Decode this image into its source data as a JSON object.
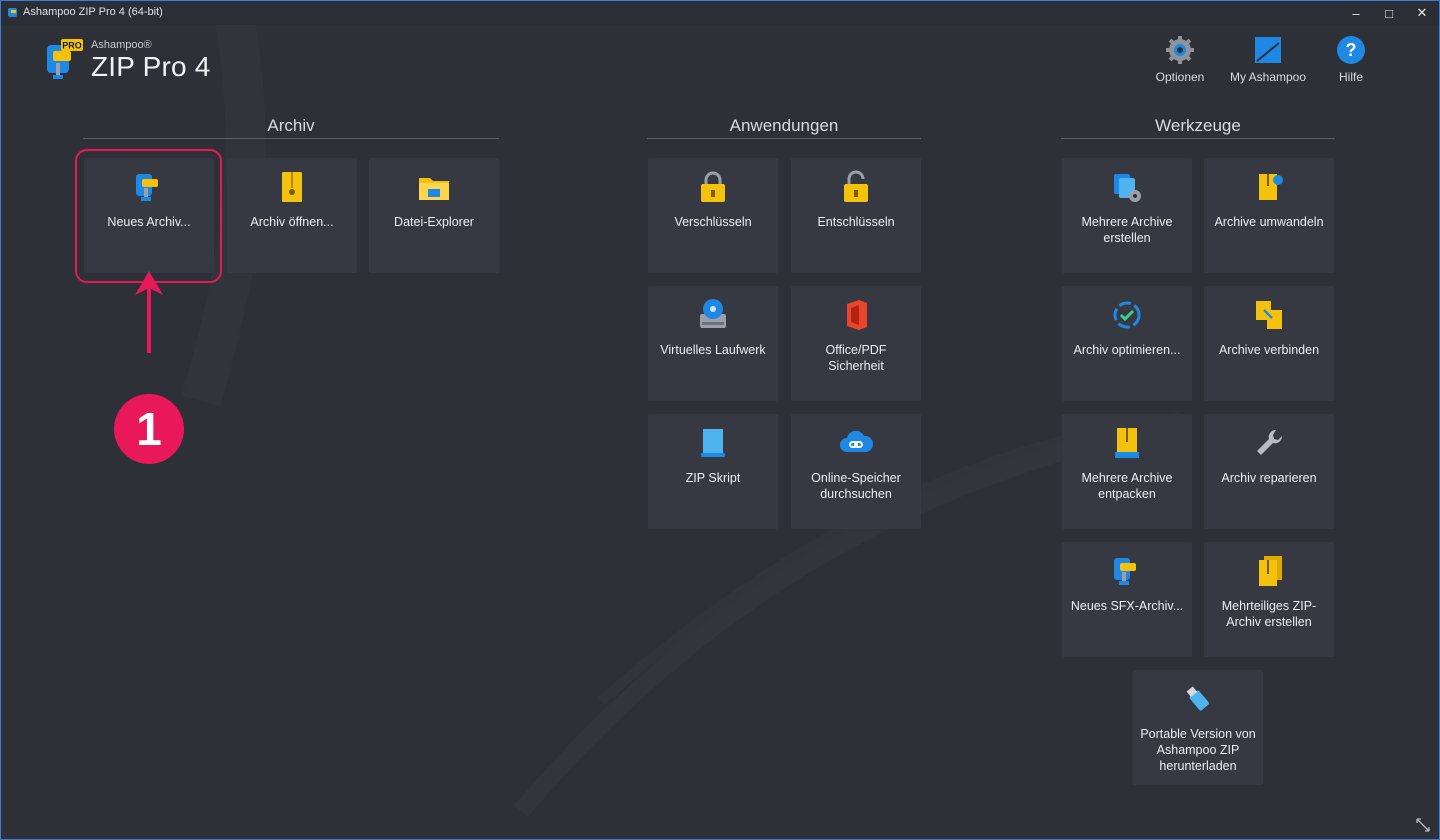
{
  "window": {
    "title": "Ashampoo ZIP Pro 4 (64-bit)",
    "controls": {
      "minimize": "–",
      "maximize": "□",
      "close": "✕"
    }
  },
  "logo": {
    "brand_small": "Ashampoo®",
    "brand_big": "ZIP Pro 4",
    "badge": "PRO"
  },
  "top_buttons": [
    {
      "label": "Optionen",
      "icon": "gear-icon"
    },
    {
      "label": "My Ashampoo",
      "icon": "ashampoo-icon"
    },
    {
      "label": "Hilfe",
      "icon": "help-icon"
    }
  ],
  "sections": {
    "archiv": {
      "title": "Archiv",
      "tiles": [
        {
          "label": "Neues Archiv...",
          "icon": "new-archive-icon"
        },
        {
          "label": "Archiv öffnen...",
          "icon": "open-archive-icon"
        },
        {
          "label": "Datei-Explorer",
          "icon": "folder-icon"
        }
      ]
    },
    "anwendungen": {
      "title": "Anwendungen",
      "tiles": [
        {
          "label": "Verschlüsseln",
          "icon": "lock-icon"
        },
        {
          "label": "Entschlüsseln",
          "icon": "unlock-icon"
        },
        {
          "label": "Virtuelles Laufwerk",
          "icon": "virtual-drive-icon"
        },
        {
          "label": "Office/PDF Sicherheit",
          "icon": "office-icon"
        },
        {
          "label": "ZIP Skript",
          "icon": "script-icon"
        },
        {
          "label": "Online-Speicher durchsuchen",
          "icon": "cloud-icon"
        }
      ]
    },
    "werkzeuge": {
      "title": "Werkzeuge",
      "tiles": [
        {
          "label": "Mehrere Archive erstellen",
          "icon": "multi-archive-icon"
        },
        {
          "label": "Archive umwandeln",
          "icon": "convert-icon"
        },
        {
          "label": "Archiv optimieren...",
          "icon": "optimize-icon"
        },
        {
          "label": "Archive verbinden",
          "icon": "merge-icon"
        },
        {
          "label": "Mehrere Archive entpacken",
          "icon": "extract-icon"
        },
        {
          "label": "Archiv reparieren",
          "icon": "wrench-icon"
        },
        {
          "label": "Neues SFX-Archiv...",
          "icon": "sfx-icon"
        },
        {
          "label": "Mehrteiliges ZIP-Archiv erstellen",
          "icon": "multipart-icon"
        },
        {
          "label": "Portable Version von Ashampoo ZIP herunterladen",
          "icon": "usb-icon"
        }
      ]
    }
  },
  "annotation": {
    "step": "1",
    "color": "#e8185a"
  },
  "colors": {
    "background": "#2d3037",
    "tile": "#363942",
    "accent_blue": "#1e88e5",
    "accent_yellow": "#f4c20d"
  }
}
